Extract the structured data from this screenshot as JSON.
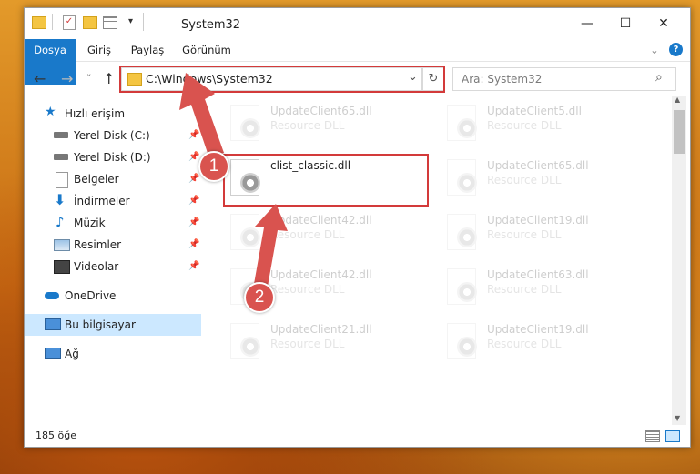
{
  "window": {
    "title": "System32",
    "controls": {
      "minimize": "—",
      "maximize": "☐",
      "close": "✕"
    }
  },
  "ribbon": {
    "tabs": [
      "Dosya",
      "Giriş",
      "Paylaş",
      "Görünüm"
    ],
    "expand": "⌄",
    "help": "?"
  },
  "nav": {
    "back": "←",
    "forward": "→",
    "recent": "˅",
    "up": "↑",
    "address": "C:\\Windows\\System32",
    "address_dropdown": "⌄",
    "refresh": "↻",
    "search_placeholder": "Ara: System32",
    "search_icon": "⌕"
  },
  "sidebar": {
    "items": [
      {
        "label": "Hızlı erişim",
        "icon": "star-icon"
      },
      {
        "label": "Yerel Disk (C:)",
        "icon": "drive-icon",
        "pinned": true
      },
      {
        "label": "Yerel Disk (D:)",
        "icon": "drive-icon",
        "pinned": true
      },
      {
        "label": "Belgeler",
        "icon": "document-icon",
        "pinned": true
      },
      {
        "label": "İndirmeler",
        "icon": "download-icon",
        "pinned": true
      },
      {
        "label": "Müzik",
        "icon": "music-icon",
        "pinned": true
      },
      {
        "label": "Resimler",
        "icon": "pictures-icon",
        "pinned": true
      },
      {
        "label": "Videolar",
        "icon": "video-icon",
        "pinned": true
      },
      {
        "label": "OneDrive",
        "icon": "cloud-icon"
      },
      {
        "label": "Bu bilgisayar",
        "icon": "computer-icon",
        "selected": true
      },
      {
        "label": "Ağ",
        "icon": "network-icon"
      }
    ],
    "pin_glyph": "📌"
  },
  "files": [
    {
      "name": "UpdateClient65.dll",
      "type": "Resource DLL"
    },
    {
      "name": "UpdateClient5.dll",
      "type": "Resource DLL"
    },
    {
      "name": "clist_classic.dll",
      "type": ""
    },
    {
      "name": "UpdateClient65.dll",
      "type": "Resource DLL"
    },
    {
      "name": "UpdateClient42.dll",
      "type": "Resource DLL"
    },
    {
      "name": "UpdateClient19.dll",
      "type": "Resource DLL"
    },
    {
      "name": "UpdateClient42.dll",
      "type": "Resource DLL"
    },
    {
      "name": "UpdateClient63.dll",
      "type": "Resource DLL"
    },
    {
      "name": "UpdateClient21.dll",
      "type": "Resource DLL"
    },
    {
      "name": "UpdateClient19.dll",
      "type": "Resource DLL"
    }
  ],
  "status": {
    "item_count": "185 öğe"
  },
  "annotations": {
    "marker1": "1",
    "marker2": "2"
  },
  "colors": {
    "accent": "#1979ca",
    "highlight": "#d33a3a",
    "selected": "#cce8ff"
  }
}
